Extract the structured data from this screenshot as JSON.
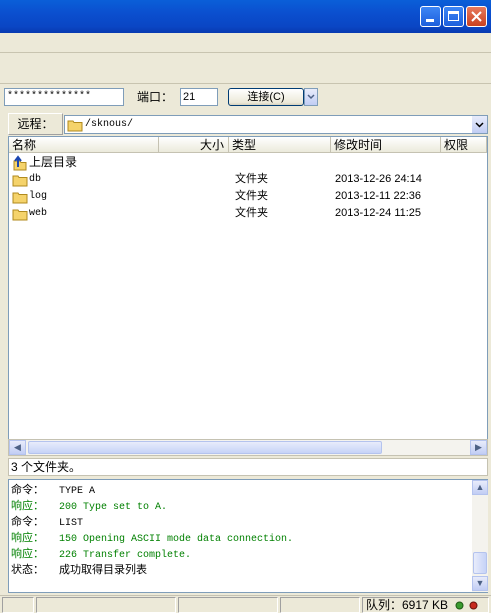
{
  "connection": {
    "password_mask": "**************",
    "port_label": "端口：",
    "port_value": "21",
    "connect_button": "连接(C)"
  },
  "remote": {
    "label": "远程：",
    "path": "/sknous/"
  },
  "columns": {
    "name": "名称",
    "size": "大小",
    "type": "类型",
    "modified": "修改时间",
    "perm": "权限"
  },
  "files": [
    {
      "name": "上层目录",
      "type": "",
      "modified": "",
      "icon": "up-folder-icon"
    },
    {
      "name": "db",
      "type": "文件夹",
      "modified": "2013-12-26 24:14",
      "icon": "folder-icon"
    },
    {
      "name": "log",
      "type": "文件夹",
      "modified": "2013-12-11 22:36",
      "icon": "folder-icon"
    },
    {
      "name": "web",
      "type": "文件夹",
      "modified": "2013-12-24 11:25",
      "icon": "folder-icon"
    }
  ],
  "folder_count": "3 个文件夹。",
  "log": [
    {
      "k": "命令：",
      "v": "TYPE A",
      "color": "#000000"
    },
    {
      "k": "响应：",
      "v": "200 Type set to A.",
      "color": "#008000"
    },
    {
      "k": "命令：",
      "v": "LIST",
      "color": "#000000"
    },
    {
      "k": "响应：",
      "v": "150 Opening ASCII mode data connection.",
      "color": "#008000"
    },
    {
      "k": "响应：",
      "v": "226 Transfer complete.",
      "color": "#008000"
    },
    {
      "k": "状态：",
      "v": "成功取得目录列表",
      "color": "#000000"
    }
  ],
  "queue": "队列：6917 KB",
  "colors": {
    "titlebar": "#0a4fcf",
    "response": "#008000"
  }
}
